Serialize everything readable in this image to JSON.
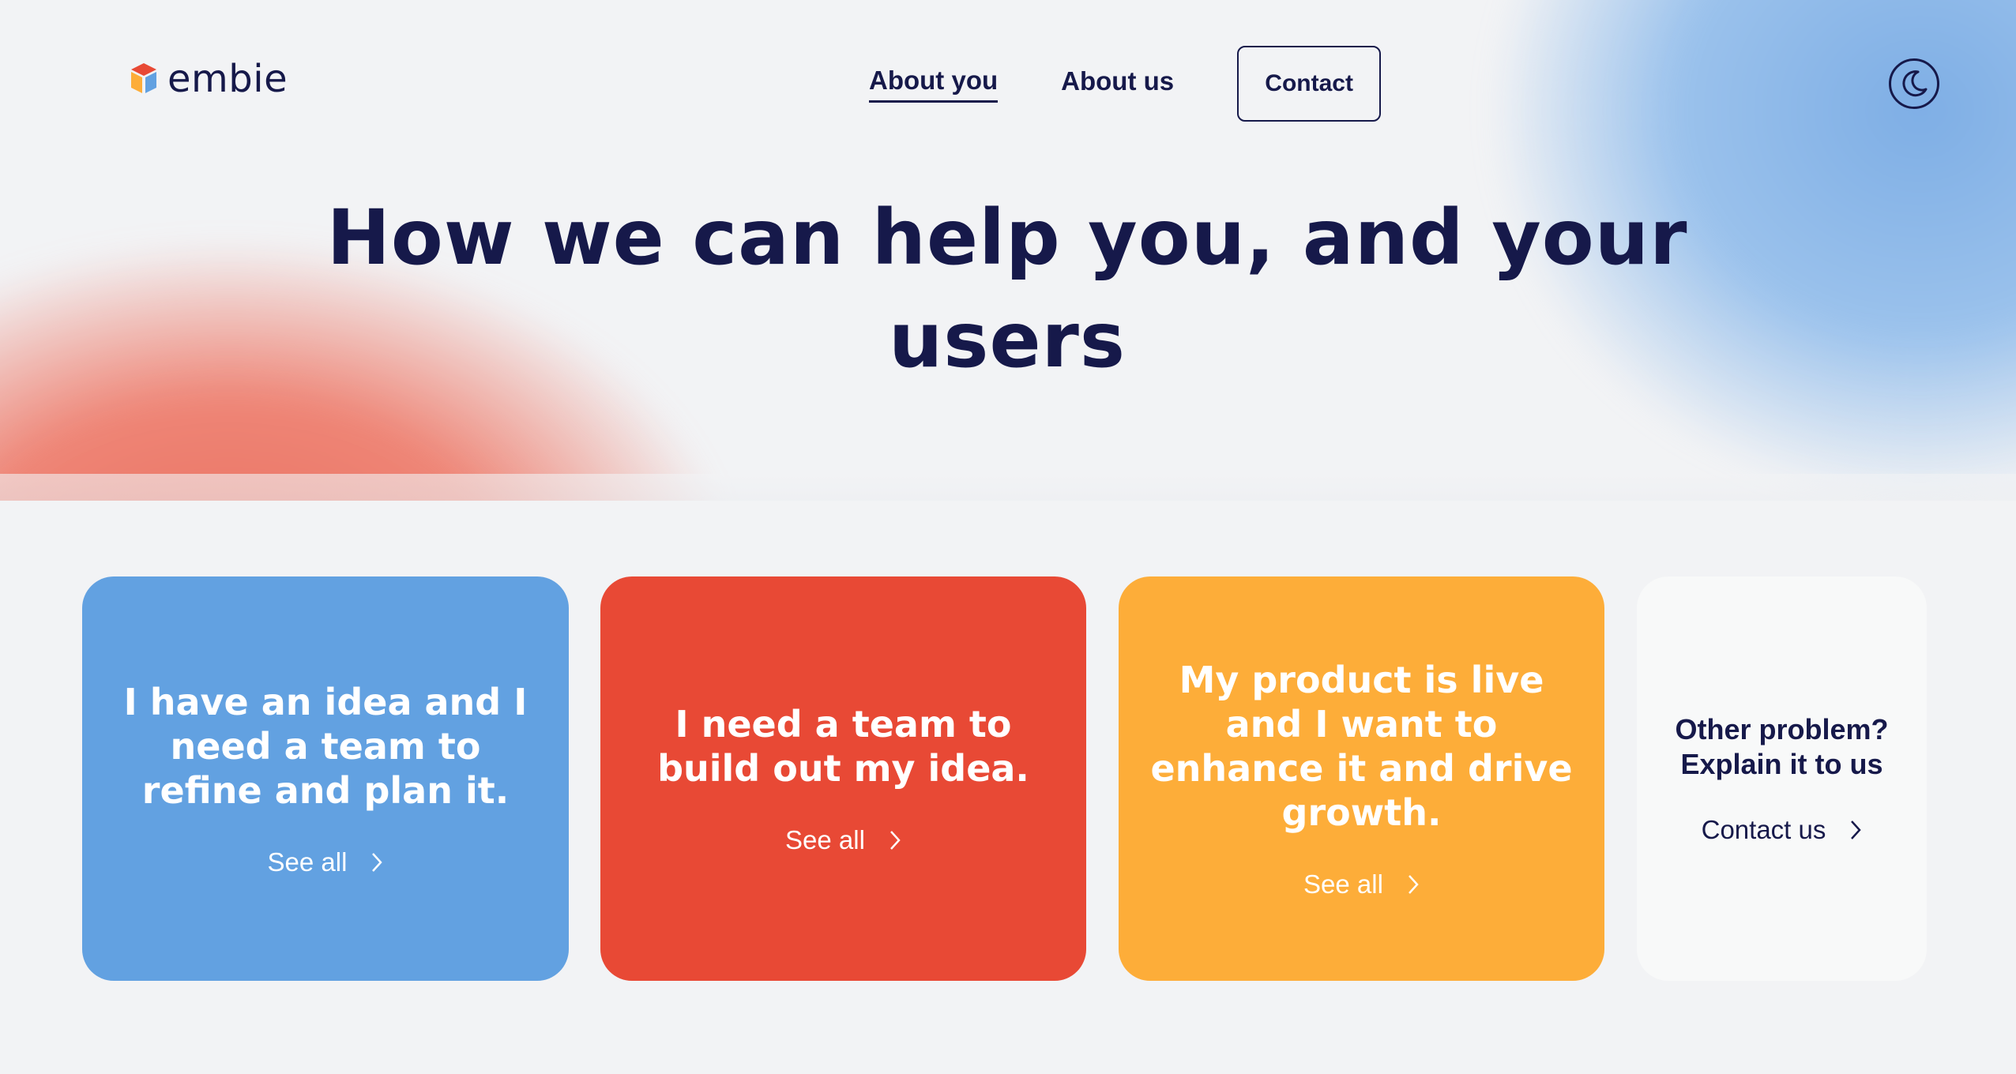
{
  "brand": {
    "name": "embie"
  },
  "nav": {
    "items": [
      {
        "label": "About you",
        "active": true
      },
      {
        "label": "About us",
        "active": false
      }
    ],
    "contact_label": "Contact"
  },
  "hero": {
    "title": "How we can help you, and your users"
  },
  "cards": [
    {
      "text": "I have an idea and I need a team to refine and plan it.",
      "link_label": "See all",
      "color": "#62a1e1"
    },
    {
      "text": "I need a team to build out my idea.",
      "link_label": "See all",
      "color": "#e84935"
    },
    {
      "text": "My product is live and I want to enhance it and drive growth.",
      "link_label": "See all",
      "color": "#fdad39"
    },
    {
      "text": "Other problem? Explain it to us",
      "link_label": "Contact us",
      "color": "#f8f9f9"
    }
  ],
  "colors": {
    "navy": "#16194a",
    "background": "#f2f3f5",
    "blob_red": "#ec6f5e",
    "blob_blue": "#7eaee5"
  },
  "icons": [
    "logo-cube-icon",
    "moon-icon",
    "chevron-right-icon"
  ]
}
